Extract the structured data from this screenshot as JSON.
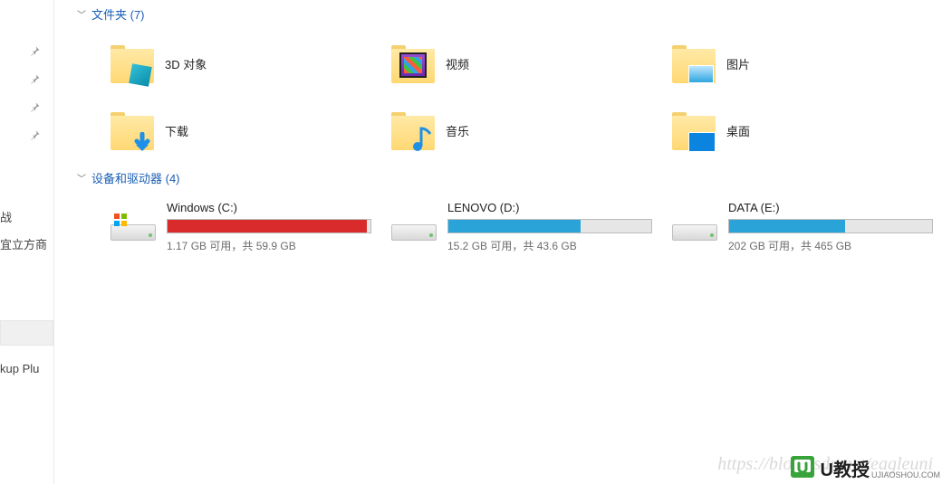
{
  "sidebar": {
    "item1": "战",
    "item2": "宜立方商",
    "item3": "kup Plu"
  },
  "groups": {
    "folders_label": "文件夹 (7)",
    "drives_label": "设备和驱动器 (4)"
  },
  "folders": [
    {
      "label": "3D 对象",
      "kind": "cube"
    },
    {
      "label": "视频",
      "kind": "video"
    },
    {
      "label": "图片",
      "kind": "pic"
    },
    {
      "label": "下载",
      "kind": "dl"
    },
    {
      "label": "音乐",
      "kind": "music"
    },
    {
      "label": "桌面",
      "kind": "desk"
    }
  ],
  "drives": [
    {
      "name": "Windows (C:)",
      "stat": "1.17 GB 可用，共 59.9 GB",
      "fill_pct": 98,
      "color": "#d92b2b",
      "os": true
    },
    {
      "name": "LENOVO (D:)",
      "stat": "15.2 GB 可用，共 43.6 GB",
      "fill_pct": 65,
      "color": "#29a3d8",
      "os": false
    },
    {
      "name": "DATA (E:)",
      "stat": "202 GB 可用，共 465 GB",
      "fill_pct": 57,
      "color": "#29a3d8",
      "os": false
    }
  ],
  "watermark": "https://blog.csdn.net/eagleuni",
  "badge": {
    "title": "U教授",
    "sub": "UJIAOSHOU.COM"
  }
}
